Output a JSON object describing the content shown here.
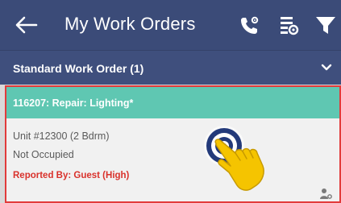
{
  "app_bar": {
    "title": "My Work Orders",
    "back_icon": "arrow-left-icon",
    "icons": [
      "phone-settings-icon",
      "filter-settings-icon",
      "funnel-icon"
    ],
    "background": "#3b4b78"
  },
  "section": {
    "label": "Standard Work Order (1)",
    "chevron_icon": "chevron-down-icon",
    "background": "#3f4f7d"
  },
  "work_order": {
    "title": "116207:  Repair: Lighting*",
    "unit": "Unit #12300 (2 Bdrm)",
    "occupancy": "Not Occupied",
    "reported_by": "Reported By: Guest  (High)",
    "header_color": "#5fc7b2",
    "highlight_color": "#e23b3b",
    "assign_icon": "person-settings-icon"
  },
  "overlay": {
    "tap_icon": "tap-target-icon",
    "hand_icon": "pointing-hand-icon"
  }
}
